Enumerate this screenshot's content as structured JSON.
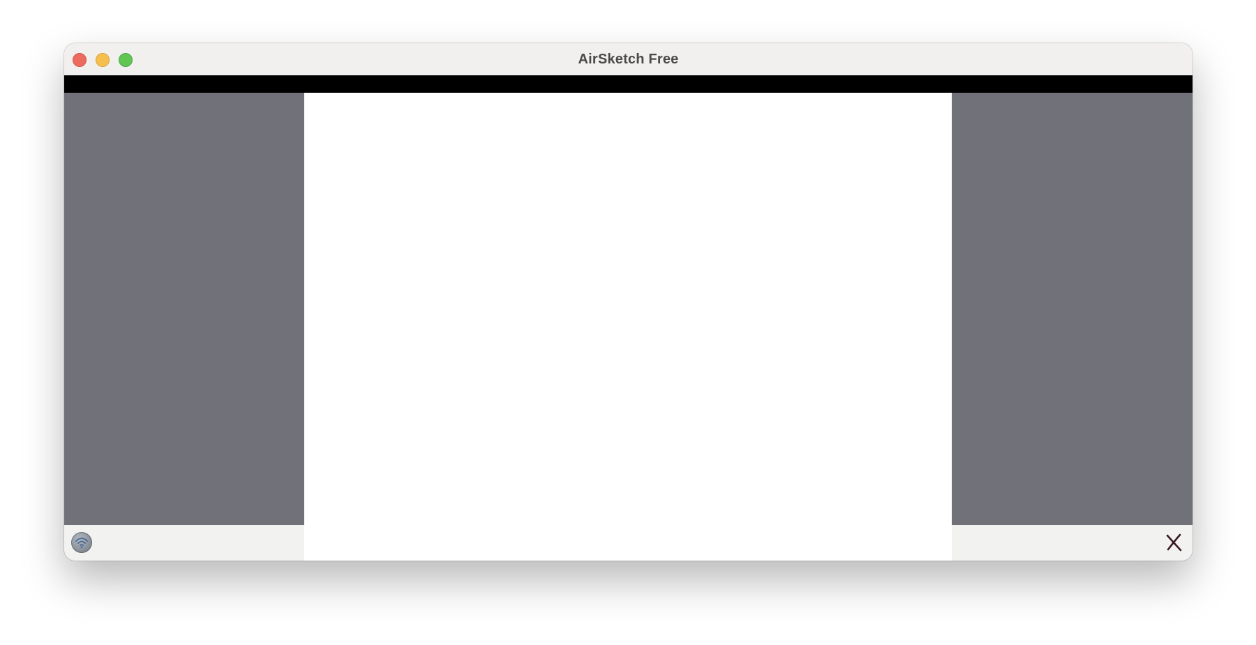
{
  "window": {
    "title": "AirSketch Free"
  },
  "colors": {
    "close": "#ed6a5e",
    "minimize": "#f5bf4f",
    "zoom": "#61c554",
    "side_panel": "#71717a",
    "toolbar_strip": "#000000",
    "canvas": "#ffffff",
    "bottombar": "#f2f2f0",
    "close_x": "#3a1a22"
  },
  "icons": {
    "connect": "wifi-icon",
    "clear": "close-icon"
  }
}
